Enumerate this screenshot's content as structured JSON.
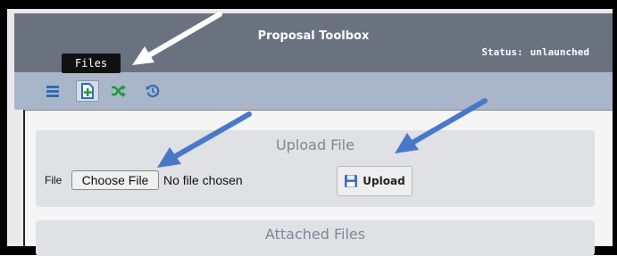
{
  "window": {
    "title": "Proposal Toolbox",
    "status_label": "Status:",
    "status_value": "unlaunched"
  },
  "toolbar": {
    "tooltip": "Files",
    "buttons": [
      {
        "icon": "menu-icon"
      },
      {
        "icon": "add-file-icon",
        "active": true
      },
      {
        "icon": "shuffle-icon"
      },
      {
        "icon": "history-icon"
      }
    ]
  },
  "upload_panel": {
    "title": "Upload File",
    "file_label": "File",
    "choose_button": "Choose File",
    "no_file_text": "No file chosen",
    "upload_button": "Upload"
  },
  "attached_panel": {
    "title": "Attached Files"
  },
  "colors": {
    "titlebar": "#6a7280",
    "toolbar": "#a9b6ca",
    "icon_blue": "#2e6db4",
    "icon_green": "#1f9a3a",
    "annotation_arrow": "#4a78c8"
  }
}
